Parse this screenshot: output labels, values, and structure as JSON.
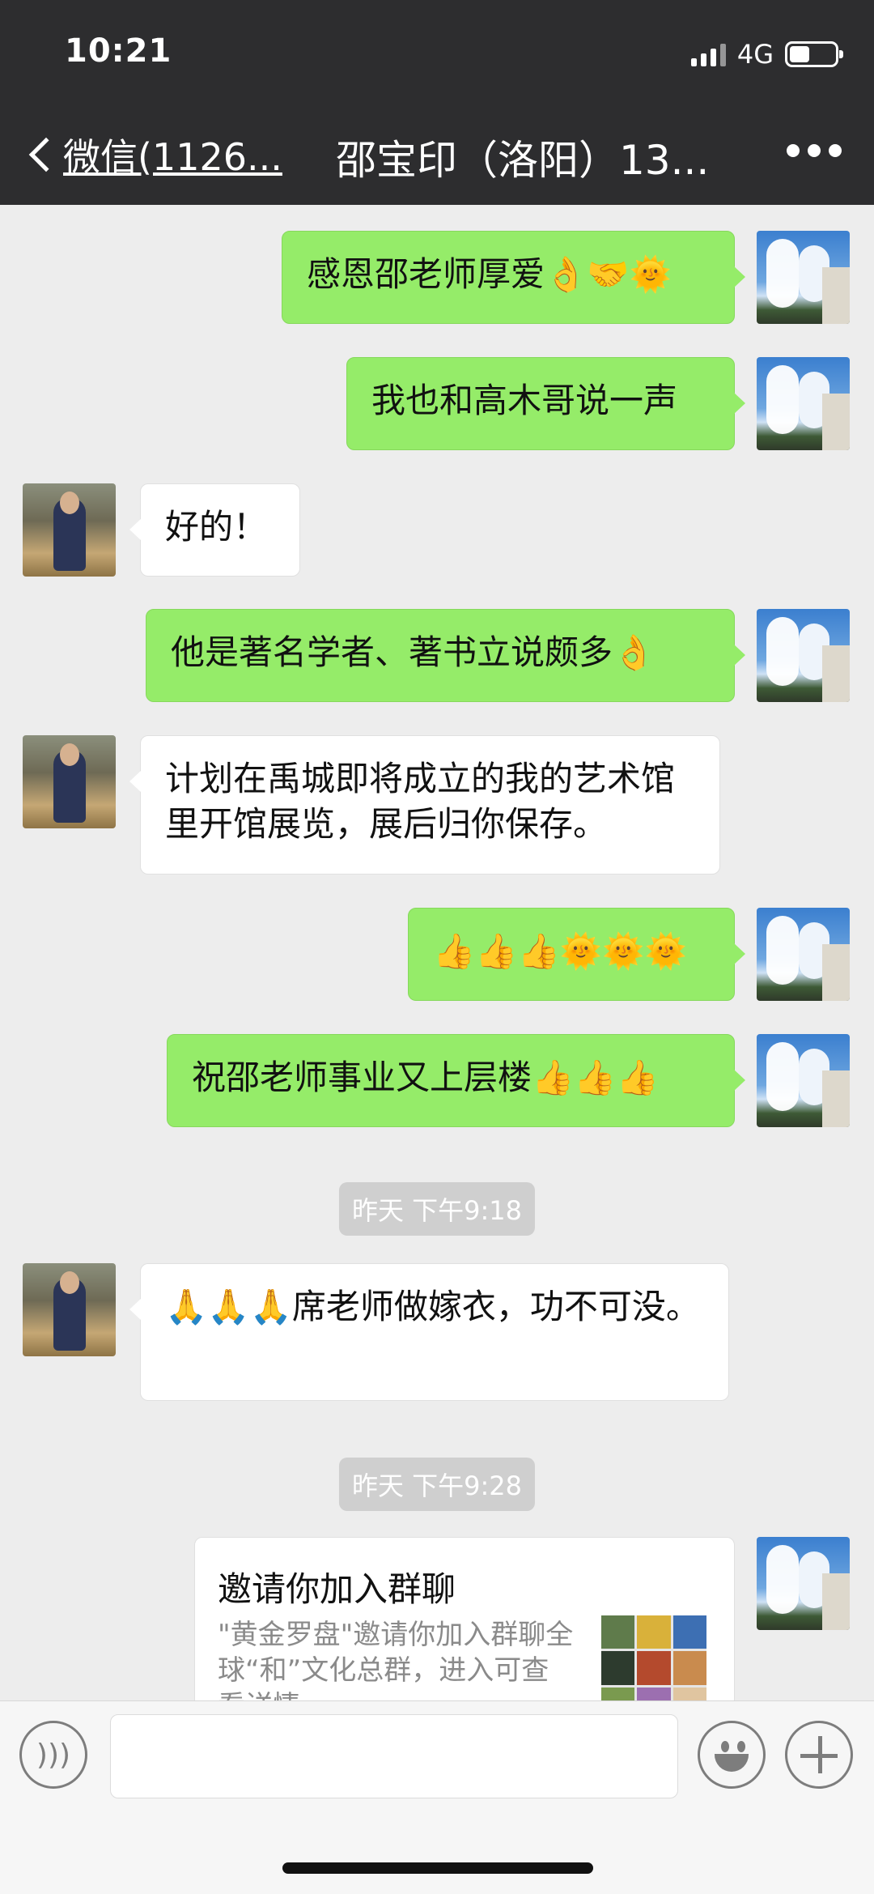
{
  "status": {
    "time": "10:21",
    "network": "4G"
  },
  "nav": {
    "back_label": "微信(1126...",
    "title": "邵宝印（洛阳）13..."
  },
  "messages": [
    {
      "side": "me",
      "text": "感恩邵老师厚爱👌🤝🌞"
    },
    {
      "side": "me",
      "text": "我也和高木哥说一声"
    },
    {
      "side": "them",
      "text": "好的！"
    },
    {
      "side": "me",
      "text": "他是著名学者、著书立说颇多👌"
    },
    {
      "side": "them",
      "text": "计划在禹城即将成立的我的艺术馆里开馆展览，展后归你保存。"
    },
    {
      "side": "me",
      "text": "👍👍👍🌞🌞🌞"
    },
    {
      "side": "me",
      "text": "祝邵老师事业又上层楼👍👍👍"
    },
    {
      "side": "them",
      "text": "🙏🙏🙏席老师做嫁衣，功不可没。"
    }
  ],
  "timestamps": [
    "昨天 下午9:18",
    "昨天 下午9:28"
  ],
  "invite_card": {
    "title": "邀请你加入群聊",
    "description": "\"黄金罗盘\"邀请你加入群聊全球“和”文化总群，进入可查看详情"
  },
  "colors": {
    "header": "#2d2d2f",
    "bubble_me": "#95ec69",
    "bubble_them": "#ffffff",
    "background": "#ededed"
  },
  "icons": {
    "voice": "voice-icon",
    "emoji": "emoji-icon",
    "plus": "plus-icon",
    "back": "chevron-left-icon",
    "more": "more-icon"
  }
}
